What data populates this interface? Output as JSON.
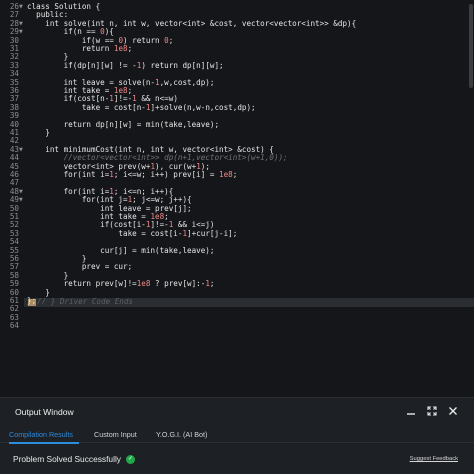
{
  "editor": {
    "first_line_number": 26,
    "lines": [
      {
        "text": "class Solution {",
        "type": "code",
        "fold": true
      },
      {
        "text": "  public:",
        "type": "code",
        "fold": false
      },
      {
        "text": "    int solve(int n, int w, vector<int> &cost, vector<vector<int>> &dp){",
        "type": "code",
        "fold": true
      },
      {
        "text": "        if(n == 0){",
        "type": "code",
        "fold": true
      },
      {
        "text": "            if(w == 0) return 0;",
        "type": "code",
        "fold": false
      },
      {
        "text": "            return 1e8;",
        "type": "code",
        "fold": false
      },
      {
        "text": "        }",
        "type": "code",
        "fold": false
      },
      {
        "text": "        if(dp[n][w] != -1) return dp[n][w];",
        "type": "code",
        "fold": false
      },
      {
        "text": "",
        "type": "code",
        "fold": false
      },
      {
        "text": "        int leave = solve(n-1,w,cost,dp);",
        "type": "code",
        "fold": false
      },
      {
        "text": "        int take = 1e8;",
        "type": "code",
        "fold": false
      },
      {
        "text": "        if(cost[n-1]!=-1 && n<=w)",
        "type": "code",
        "fold": false
      },
      {
        "text": "            take = cost[n-1]+solve(n,w-n,cost,dp);",
        "type": "code",
        "fold": false
      },
      {
        "text": "",
        "type": "code",
        "fold": false
      },
      {
        "text": "        return dp[n][w] = min(take,leave);",
        "type": "code",
        "fold": false
      },
      {
        "text": "    }",
        "type": "code",
        "fold": false
      },
      {
        "text": "",
        "type": "code",
        "fold": false
      },
      {
        "text": "    int minimumCost(int n, int w, vector<int> &cost) {",
        "type": "code",
        "fold": true
      },
      {
        "text": "        //vector<vector<int>> dp(n+1,vector<int>(w+1,0));",
        "type": "comment",
        "fold": false
      },
      {
        "text": "        vector<int> prev(w+1), cur(w+1);",
        "type": "code",
        "fold": false
      },
      {
        "text": "        for(int i=1; i<=w; i++) prev[i] = 1e8;",
        "type": "code",
        "fold": false
      },
      {
        "text": "",
        "type": "code",
        "fold": false
      },
      {
        "text": "        for(int i=1; i<=n; i++){",
        "type": "code",
        "fold": true
      },
      {
        "text": "            for(int j=1; j<=w; j++){",
        "type": "code",
        "fold": true
      },
      {
        "text": "                int leave = prev[j];",
        "type": "code",
        "fold": false
      },
      {
        "text": "                int take = 1e8;",
        "type": "code",
        "fold": false
      },
      {
        "text": "                if(cost[i-1]!=-1 && i<=j)",
        "type": "code",
        "fold": false
      },
      {
        "text": "                    take = cost[i-1]+cur[j-i];",
        "type": "code",
        "fold": false
      },
      {
        "text": "",
        "type": "code",
        "fold": false
      },
      {
        "text": "                cur[j] = min(take,leave);",
        "type": "code",
        "fold": false
      },
      {
        "text": "            }",
        "type": "code",
        "fold": false
      },
      {
        "text": "            prev = cur;",
        "type": "code",
        "fold": false
      },
      {
        "text": "        }",
        "type": "code",
        "fold": false
      },
      {
        "text": "        return prev[w]!=1e8 ? prev[w]:-1;",
        "type": "code",
        "fold": false
      },
      {
        "text": "    }",
        "type": "code",
        "fold": false
      },
      {
        "text": "};",
        "type": "code",
        "fold": false
      },
      {
        "text": "",
        "type": "code",
        "fold": false
      },
      {
        "text": "",
        "type": "code",
        "fold": false
      },
      {
        "text": "",
        "type": "code",
        "fold": false
      }
    ],
    "inline_hint": "// } Driver Code Ends"
  },
  "output_window": {
    "title": "Output Window",
    "controls": [
      "minimize-icon",
      "expand-icon",
      "close-icon"
    ],
    "tabs": [
      {
        "label": "Compilation Results",
        "active": true
      },
      {
        "label": "Custom Input",
        "active": false
      },
      {
        "label": "Y.O.G.I. (AI Bot)",
        "active": false
      }
    ],
    "status": "Problem Solved Successfully",
    "status_icon": "check-circle-icon",
    "feedback_link": "Suggest Feedback"
  },
  "colors": {
    "editor_bg": "#141619",
    "panel_bg": "#1d2024",
    "accent": "#2f8bdc",
    "success": "#22a84a",
    "number": "#f08a8a"
  }
}
